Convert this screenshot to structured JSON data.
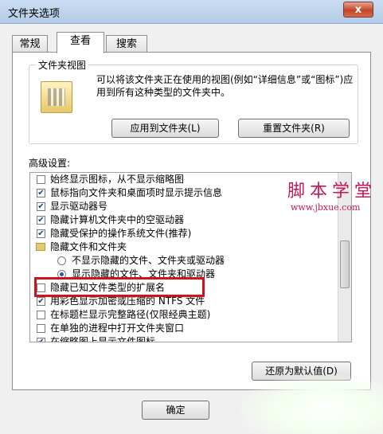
{
  "window": {
    "title": "文件夹选项",
    "close_symbol": "x"
  },
  "tabs": [
    {
      "label": "常规",
      "active": false
    },
    {
      "label": "查看",
      "active": true
    },
    {
      "label": "搜索",
      "active": false
    }
  ],
  "folder_views": {
    "label": "文件夹视图",
    "description": "可以将该文件夹正在使用的视图(例如“详细信息”或“图标”)应用到所有这种类型的文件夹中。",
    "apply_button": "应用到文件夹(L)",
    "reset_button": "重置文件夹(R)"
  },
  "advanced": {
    "label": "高级设置:",
    "items": [
      {
        "type": "checkbox",
        "checked": false,
        "text": "始终显示图标，从不显示缩略图"
      },
      {
        "type": "checkbox",
        "checked": true,
        "text": "鼠标指向文件夹和桌面项时显示提示信息"
      },
      {
        "type": "checkbox",
        "checked": true,
        "text": "显示驱动器号"
      },
      {
        "type": "checkbox",
        "checked": true,
        "text": "隐藏计算机文件夹中的空驱动器"
      },
      {
        "type": "checkbox",
        "checked": true,
        "text": "隐藏受保护的操作系统文件(推荐)"
      },
      {
        "type": "folder",
        "text": "隐藏文件和文件夹"
      },
      {
        "type": "radio",
        "checked": false,
        "text": "不显示隐藏的文件、文件夹或驱动器"
      },
      {
        "type": "radio",
        "checked": true,
        "text": "显示隐藏的文件、文件夹和驱动器"
      },
      {
        "type": "checkbox",
        "checked": false,
        "text": "隐藏已知文件类型的扩展名"
      },
      {
        "type": "checkbox",
        "checked": true,
        "text": "用彩色显示加密或压缩的 NTFS 文件"
      },
      {
        "type": "checkbox",
        "checked": false,
        "text": "在标题栏显示完整路径(仅限经典主题)"
      },
      {
        "type": "checkbox",
        "checked": false,
        "text": "在单独的进程中打开文件夹窗口"
      },
      {
        "type": "checkbox",
        "checked": true,
        "text": "在缩略图上显示文件图标"
      }
    ],
    "restore_button": "还原为默认值(D)"
  },
  "footer": {
    "ok_button": "确定"
  },
  "watermark": {
    "line1": "脚本学堂",
    "line2": "www.jbxue.com"
  },
  "colors": {
    "highlight_border": "#d0121b",
    "watermark": "#c2185b"
  }
}
